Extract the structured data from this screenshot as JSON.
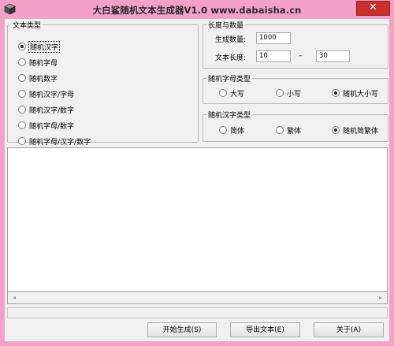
{
  "window": {
    "title": "大白鲨随机文本生成器V1.0 www.dabaisha.cn",
    "close_glyph": "✕",
    "titlebar_color": "#f4a1c8",
    "close_color": "#c9302c"
  },
  "text_type": {
    "legend": "文本类型",
    "options": [
      "随机汉字",
      "随机字母",
      "随机数字",
      "随机汉字/字母",
      "随机汉字/数字",
      "随机字母/数字",
      "随机字母/汉字/数字"
    ],
    "selected": "随机汉字"
  },
  "length_count": {
    "legend": "长度与数量",
    "count_label": "生成数量:",
    "count_value": "1000",
    "length_label": "文本长度:",
    "length_min": "10",
    "length_sep": "–",
    "length_max": "30"
  },
  "letter_type": {
    "legend": "随机字母类型",
    "options": [
      "大写",
      "小写",
      "随机大小写"
    ],
    "selected": "随机大小写"
  },
  "hanzi_type": {
    "legend": "随机汉字类型",
    "options": [
      "简体",
      "繁体",
      "随机简繁体"
    ],
    "selected": "随机简繁体"
  },
  "buttons": {
    "start": "开始生成(S)",
    "export": "导出文本(E)",
    "about": "关于(A)"
  },
  "icons": {
    "app": "cube-icon",
    "scroll_left": "◂",
    "scroll_right": "▸"
  }
}
